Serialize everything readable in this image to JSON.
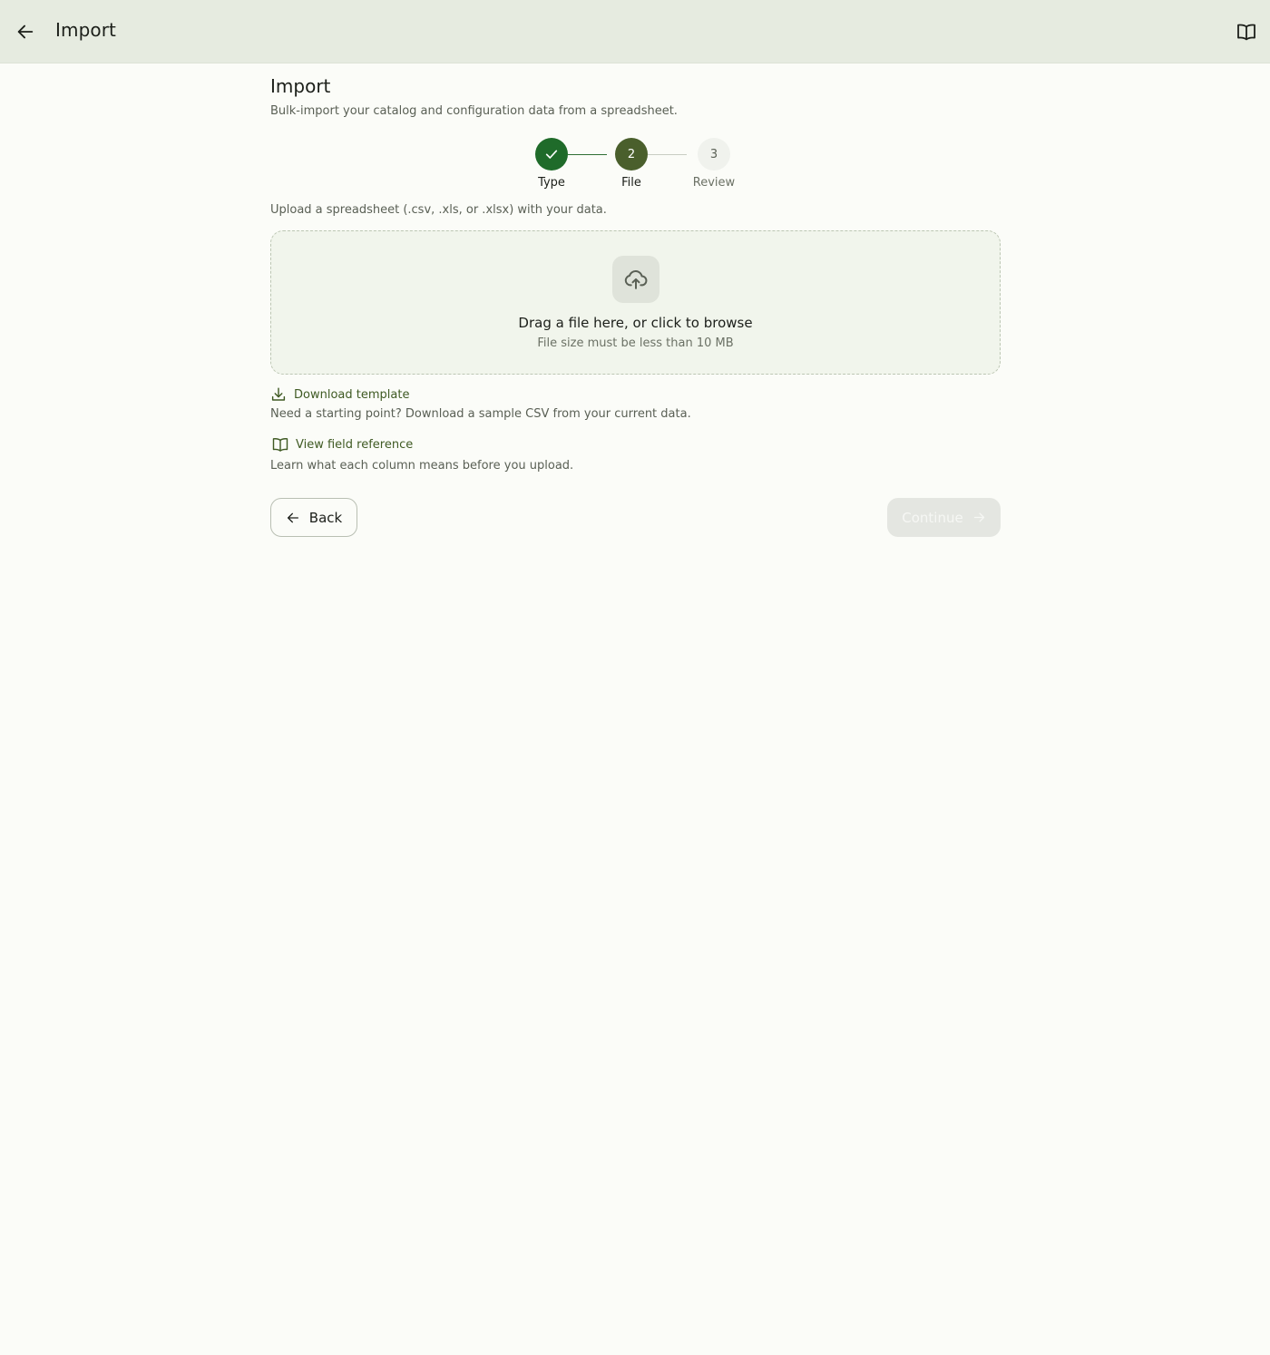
{
  "topbar": {
    "title": "Import",
    "back_icon": "arrow-left-icon",
    "help_icon": "book-open-icon"
  },
  "page": {
    "title": "Import",
    "subtitle": "Bulk-import your catalog and configuration data from a spreadsheet."
  },
  "stepper": {
    "steps": [
      {
        "number": "1",
        "label": "Type",
        "state": "completed"
      },
      {
        "number": "2",
        "label": "File",
        "state": "active"
      },
      {
        "number": "3",
        "label": "Review",
        "state": "upcoming"
      }
    ]
  },
  "upload": {
    "hint": "Upload a spreadsheet (.csv, .xls, or .xlsx) with your data.",
    "drop_title": "Drag a file here, or click to browse",
    "drop_subtitle": "File size must be less than 10 MB",
    "icon": "cloud-upload-icon"
  },
  "links": {
    "download_template": {
      "label": "Download template",
      "description": "Need a starting point? Download a sample CSV from your current data.",
      "icon": "download-icon"
    },
    "field_reference": {
      "label": "View field reference",
      "description": "Learn what each column means before you upload.",
      "icon": "book-open-icon"
    }
  },
  "actions": {
    "back_label": "Back",
    "continue_label": "Continue",
    "continue_enabled": false
  },
  "colors": {
    "topbar_bg": "#e6ebe0",
    "page_bg": "#fbfcf8",
    "step_completed": "#1f6b2a",
    "step_active": "#4a5f2c",
    "link": "#3f5a23"
  }
}
